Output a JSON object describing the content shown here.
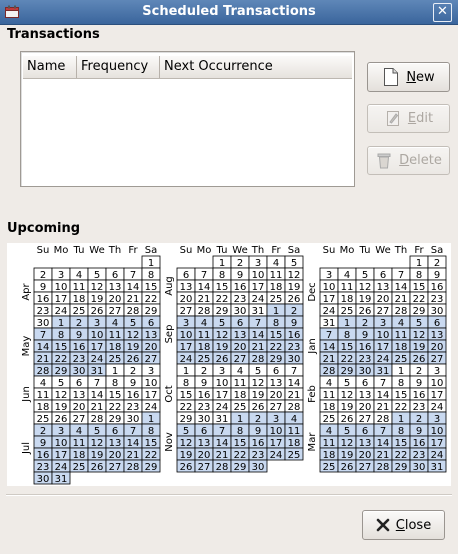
{
  "window": {
    "title": "Scheduled Transactions",
    "close_glyph": "✕",
    "app_icon": "app-icon"
  },
  "transactions": {
    "section_title": "Transactions",
    "columns": [
      "Name",
      "Frequency",
      "Next Occurrence"
    ]
  },
  "buttons": {
    "new": {
      "label_first": "N",
      "label_rest": "ew",
      "icon": "new-document-icon"
    },
    "edit": {
      "label_first": "E",
      "label_rest": "dit",
      "icon": "edit-icon"
    },
    "delete": {
      "label_first": "D",
      "label_rest": "elete",
      "icon": "trash-icon"
    },
    "close": {
      "label_first": "C",
      "label_rest": "lose",
      "icon": "close-icon"
    }
  },
  "upcoming": {
    "section_title": "Upcoming",
    "weekdays": [
      "Su",
      "Mo",
      "Tu",
      "We",
      "Th",
      "Fr",
      "Sa"
    ],
    "columns": [
      [
        {
          "name": "Apr",
          "lead": 6,
          "days": 30
        },
        {
          "name": "May",
          "lead": 1,
          "days": 31
        },
        {
          "name": "Jun",
          "lead": 4,
          "days": 30
        },
        {
          "name": "Jul",
          "lead": 6,
          "days": 31
        }
      ],
      [
        {
          "name": "Aug",
          "lead": 2,
          "days": 31
        },
        {
          "name": "Sep",
          "lead": 5,
          "days": 30
        },
        {
          "name": "Oct",
          "lead": 0,
          "days": 31
        },
        {
          "name": "Nov",
          "lead": 3,
          "days": 30
        }
      ],
      [
        {
          "name": "Dec",
          "lead": 5,
          "days": 31
        },
        {
          "name": "Jan",
          "lead": 1,
          "days": 31
        },
        {
          "name": "Feb",
          "lead": 4,
          "days": 28
        },
        {
          "name": "Mar",
          "lead": 4,
          "days": 31
        }
      ]
    ],
    "colors": {
      "shade_a": "#ffffff",
      "shade_b": "#c9d9f0",
      "grid": "#000000"
    }
  }
}
